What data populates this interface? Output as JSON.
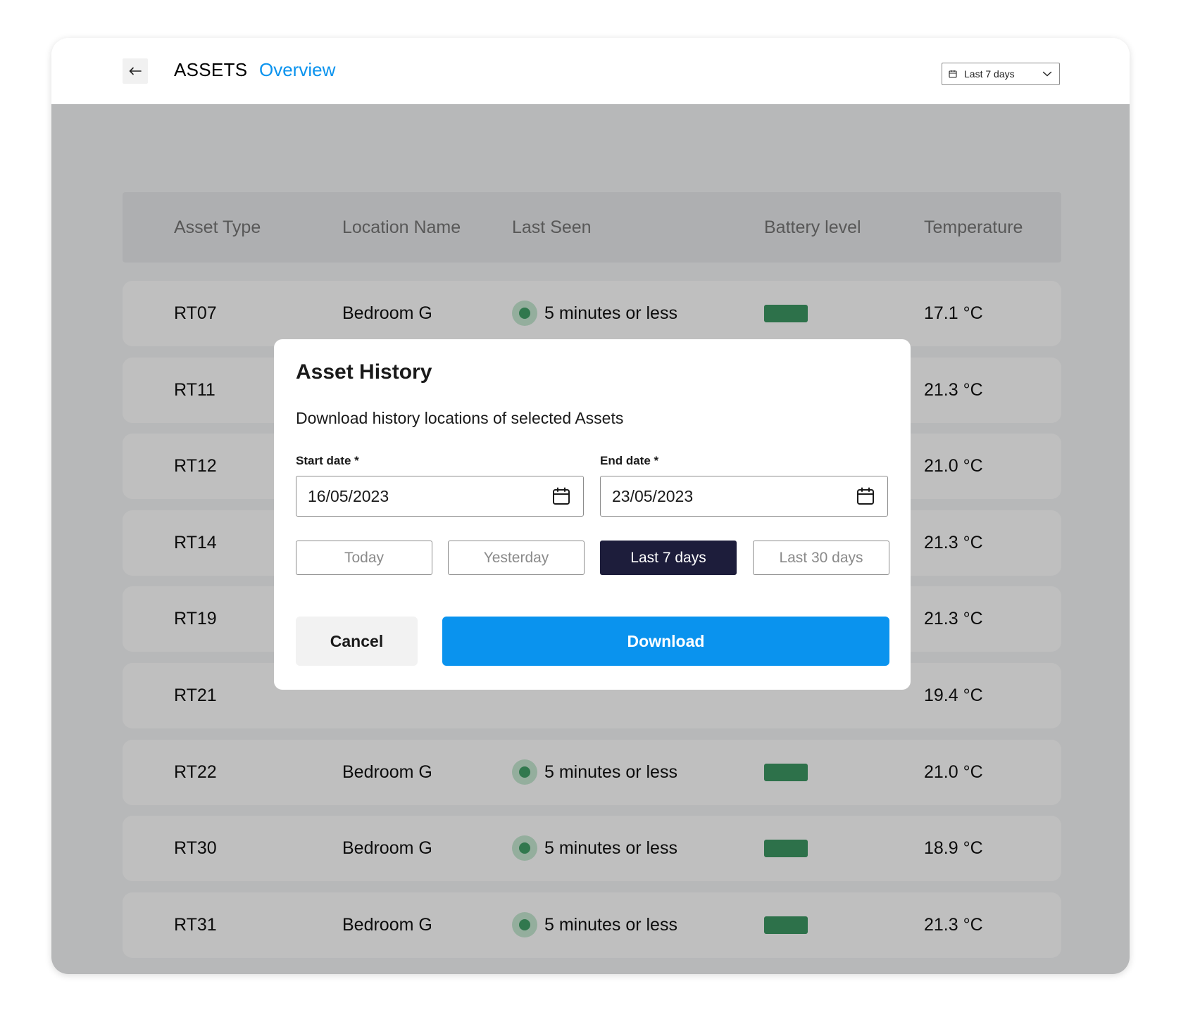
{
  "header": {
    "back_icon": "arrow-left-icon",
    "title": "ASSETS",
    "nav_link": "Overview",
    "range_select": {
      "value": "Last 7 days",
      "icon": "calendar-icon",
      "chevron": "chevron-down-icon"
    }
  },
  "table": {
    "columns": [
      "Asset Type",
      "Location Name",
      "Last Seen",
      "Battery level",
      "Temperature"
    ],
    "rows": [
      {
        "asset": "RT07",
        "location": "Bedroom G",
        "last_seen": "5 minutes or less",
        "temperature": "17.1 °C"
      },
      {
        "asset": "RT11",
        "location": "",
        "last_seen": "",
        "temperature": "21.3 °C"
      },
      {
        "asset": "RT12",
        "location": "",
        "last_seen": "",
        "temperature": "21.0 °C"
      },
      {
        "asset": "RT14",
        "location": "",
        "last_seen": "",
        "temperature": "21.3 °C"
      },
      {
        "asset": "RT19",
        "location": "",
        "last_seen": "",
        "temperature": "21.3 °C"
      },
      {
        "asset": "RT21",
        "location": "",
        "last_seen": "",
        "temperature": "19.4 °C"
      },
      {
        "asset": "RT22",
        "location": "Bedroom G",
        "last_seen": "5 minutes or less",
        "temperature": "21.0 °C"
      },
      {
        "asset": "RT30",
        "location": "Bedroom G",
        "last_seen": "5 minutes or less",
        "temperature": "18.9 °C"
      },
      {
        "asset": "RT31",
        "location": "Bedroom G",
        "last_seen": "5 minutes or less",
        "temperature": "21.3 °C"
      }
    ]
  },
  "modal": {
    "title": "Asset History",
    "description": "Download history locations of selected Assets",
    "start_label": "Start date *",
    "start_value": "16/05/2023",
    "end_label": "End date *",
    "end_value": "23/05/2023",
    "quick_ranges": [
      "Today",
      "Yesterday",
      "Last 7 days",
      "Last 30 days"
    ],
    "active_range": "Last 7 days",
    "cancel_label": "Cancel",
    "download_label": "Download"
  },
  "colors": {
    "accent": "#0a93ee",
    "active_range_bg": "#1d1d3b",
    "status_online": "#42a068",
    "battery_full": "#3d9763"
  }
}
